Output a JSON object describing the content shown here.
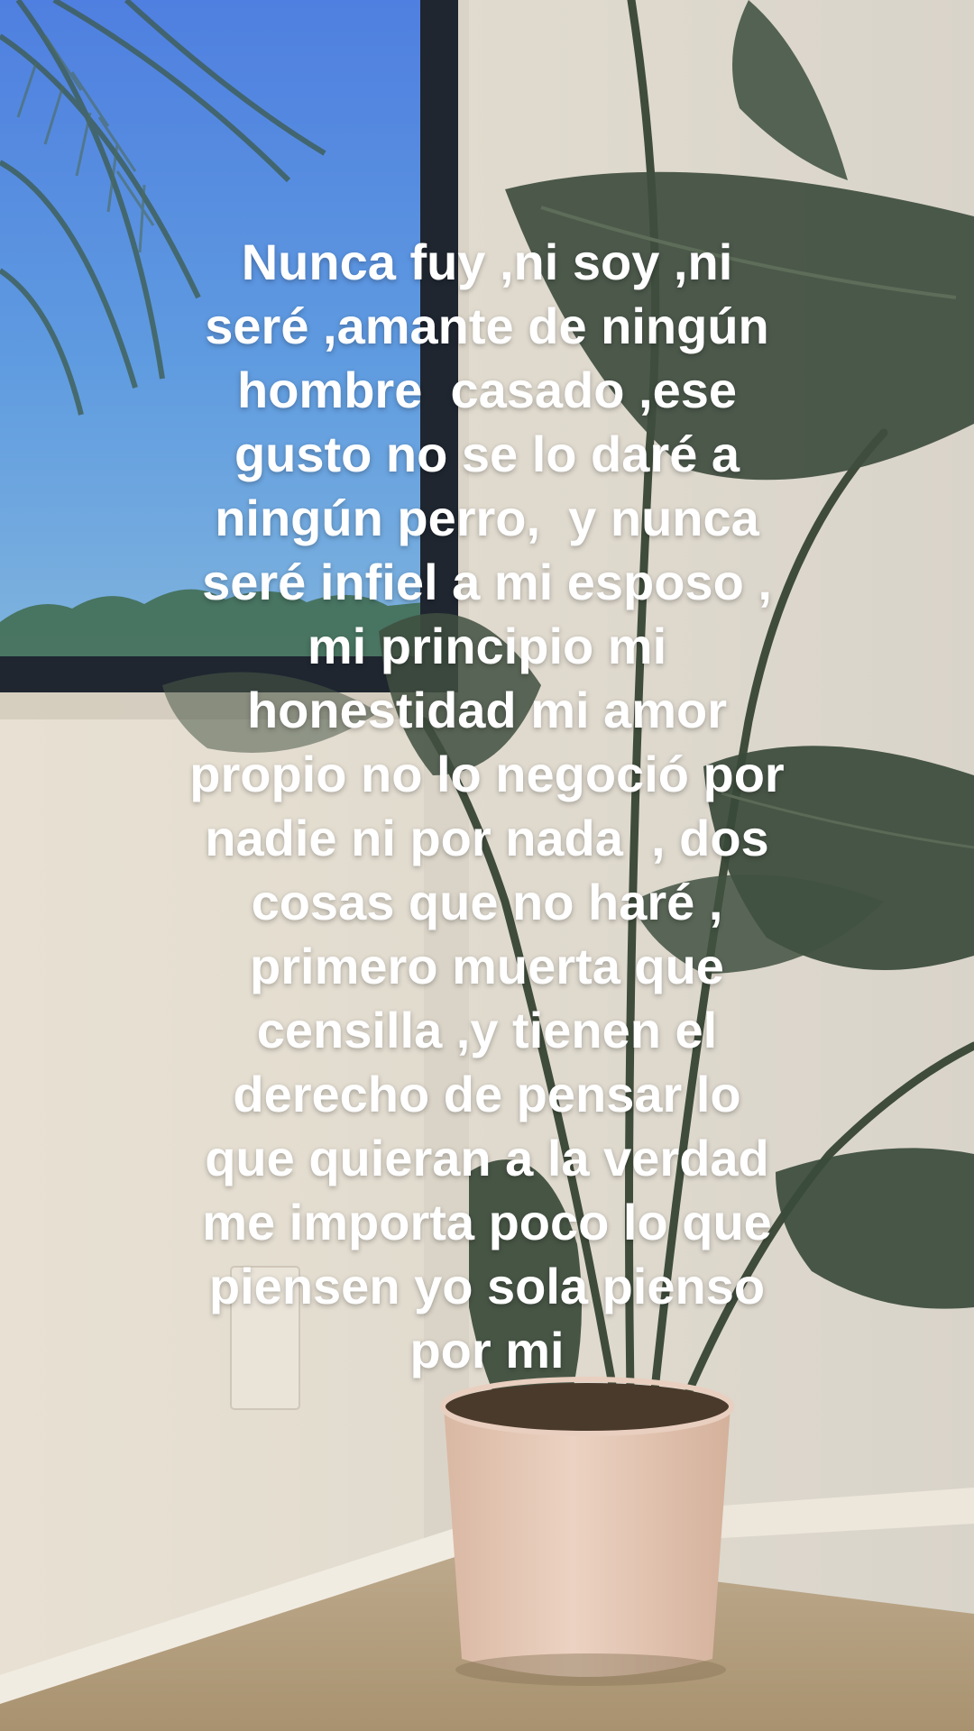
{
  "caption": {
    "lines": [
      "Nunca fuy ,ni soy ,ni",
      "seré ,amante de ningún",
      "hombre  casado ,ese",
      "gusto no se lo daré a",
      "ningún perro,  y nunca",
      "seré infiel a mi esposo ,",
      "mi principio mi",
      "honestidad mi amor",
      "propio no lo negoció por",
      "nadie ni por nada  , dos",
      "cosas que no haré ,",
      "primero muerta que",
      "censilla ,y tienen el",
      "derecho de pensar lo",
      "que quieran a la verdad",
      "me importa poco lo que",
      "piensen yo sola pienso",
      "por mi"
    ]
  },
  "colors": {
    "caption_text": "#ffffff",
    "sky": "#5b8fd8",
    "wall": "#e2dccf",
    "leaf": "#3d4a3a",
    "pot": "#e6c9b8",
    "floor": "#b8a48a"
  }
}
